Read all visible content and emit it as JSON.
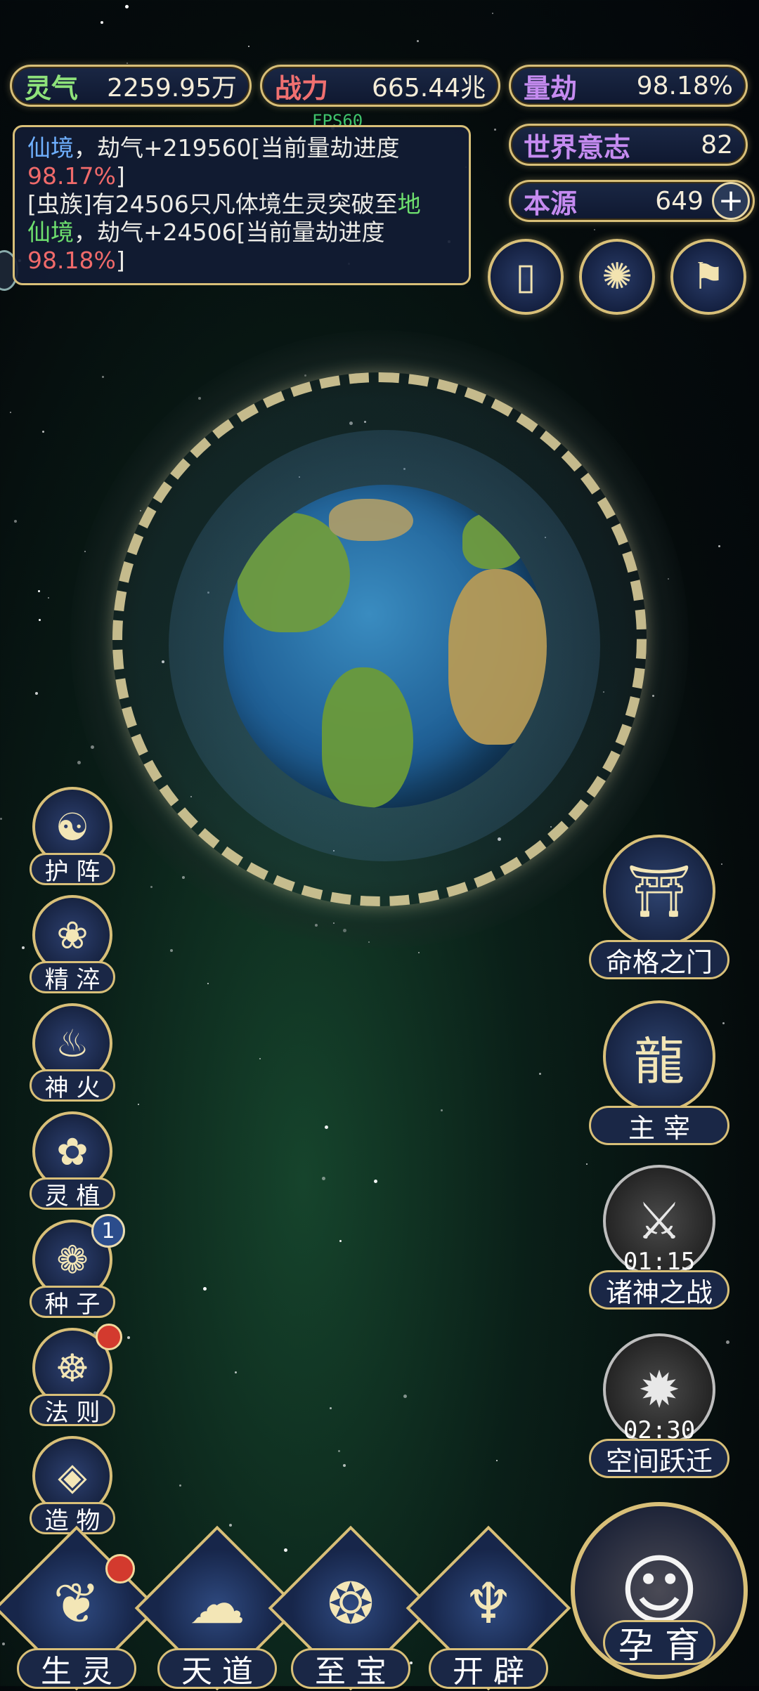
{
  "stats": {
    "lingqi": {
      "label": "灵气",
      "value": "2259.95万"
    },
    "zhanli": {
      "label": "战力",
      "value": "665.44兆"
    },
    "liangjie": {
      "label": "量劫",
      "value": "98.18%"
    },
    "shijie": {
      "label": "世界意志",
      "value": "82"
    },
    "benyuan": {
      "label": "本源",
      "value": "649",
      "plus": "+"
    }
  },
  "fps": "FPS60",
  "log": {
    "line1_a": "仙境",
    "line1_b": "，劫气+219560[当前量劫进度",
    "line1_c": "98.17%",
    "line1_d": "]",
    "line2_a": "[虫族]有24506只凡体境生灵突破至",
    "line2_b": "地",
    "line2_c": "仙境",
    "line2_d": "，劫气+24506[当前量劫进度",
    "line2_e": "98.18%",
    "line2_f": "]"
  },
  "top_icons": [
    {
      "icon": "card-icon",
      "glyph": "▯"
    },
    {
      "icon": "vortex-icon",
      "glyph": "✺"
    },
    {
      "icon": "scroll-icon",
      "glyph": "⚑"
    }
  ],
  "left_menu": [
    {
      "label": "护 阵",
      "glyph": "☯"
    },
    {
      "label": "精 淬",
      "glyph": "❀"
    },
    {
      "label": "神 火",
      "glyph": "♨"
    },
    {
      "label": "灵 植",
      "glyph": "✿"
    },
    {
      "label": "种 子",
      "glyph": "❁",
      "badge": "1"
    },
    {
      "label": "法 则",
      "glyph": "☸",
      "dot": true
    },
    {
      "label": "造 物",
      "glyph": "◈"
    }
  ],
  "right_menu": [
    {
      "label": "命格之门",
      "glyph": "⛩"
    },
    {
      "label": "主 宰",
      "glyph": "龍"
    },
    {
      "label": "诸神之战",
      "glyph": "⚔",
      "timer": "01:15"
    },
    {
      "label": "空间跃迁",
      "glyph": "✹",
      "timer": "02:30"
    }
  ],
  "bottom_menu": [
    {
      "label": "生 灵",
      "glyph": "❦"
    },
    {
      "label": "天 道",
      "glyph": "☁"
    },
    {
      "label": "至 宝",
      "glyph": "❂"
    },
    {
      "label": "开 辟",
      "glyph": "♆"
    }
  ],
  "big_button": {
    "label": "孕 育",
    "glyph": "☺"
  }
}
